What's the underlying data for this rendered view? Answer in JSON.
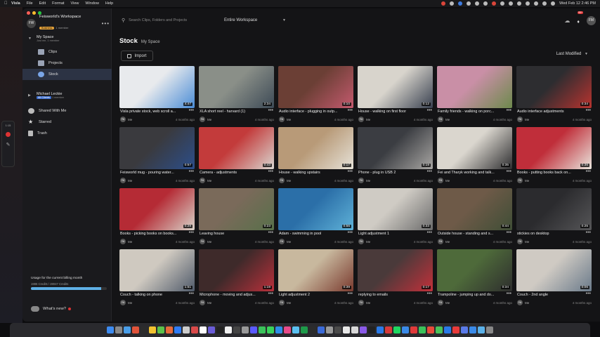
{
  "menubar": {
    "app": "Visla",
    "items": [
      "File",
      "Edit",
      "Format",
      "View",
      "Window",
      "Help"
    ],
    "clock": "Wed Feb 12  2:46 PM"
  },
  "floatbar": {
    "timer": "1:15"
  },
  "workspace": {
    "avatar": "FW",
    "name": "Feisworld's Workspace",
    "badge": "Business",
    "members": "1 member"
  },
  "search": {
    "placeholder": "Search Clips, Folders and Projects"
  },
  "scope": {
    "value": "Entire Workspace"
  },
  "user_avatar": "FM",
  "notifications": {
    "count": "99+"
  },
  "sidebar": {
    "my_space": {
      "label": "My Space",
      "sub": "Just me, 1 member"
    },
    "items": [
      {
        "label": "Clips"
      },
      {
        "label": "Projects"
      },
      {
        "label": "Stock"
      }
    ],
    "michael": {
      "label": "Michael Leckie",
      "badge": "All Clients",
      "sub": "1 member"
    },
    "shared": "Shared With Me",
    "starred": "Starred",
    "trash": "Trash"
  },
  "usage": {
    "title": "Usage for the current billing month",
    "credits": "1986 Credits / 28047 Credits",
    "fraction": 0.93
  },
  "whats_new": "What's new?",
  "page": {
    "title": "Stock",
    "subtitle": "My Space"
  },
  "import_label": "Import",
  "sort_label": "Last Modified",
  "owner": "Me",
  "owner_initials": "FM",
  "clips": [
    {
      "title": "Visla private stock, web scroll a...",
      "duration": "4:47",
      "ago": "4 months ago",
      "c1": "#e8eaed",
      "c2": "#4a8cd6"
    },
    {
      "title": "XLA short reel - harvard (1)",
      "duration": "2:34",
      "ago": "4 months ago",
      "c1": "#8a8f88",
      "c2": "#3d4a56"
    },
    {
      "title": "Audio interface - plugging in outp...",
      "duration": "0:10",
      "ago": "4 months ago",
      "c1": "#6b3f35",
      "c2": "#c45a6e"
    },
    {
      "title": "House - walking on first floor",
      "duration": "0:12",
      "ago": "4 months ago",
      "c1": "#d8d4cc",
      "c2": "#394150"
    },
    {
      "title": "Family friends - walking on porc...",
      "duration": "",
      "ago": "4 months ago",
      "c1": "#c98fa6",
      "c2": "#6d8a4c"
    },
    {
      "title": "Audio interface adjustments",
      "duration": "0:34",
      "ago": "4 months ago",
      "c1": "#2d2d30",
      "c2": "#b8332f"
    },
    {
      "title": "Feisworld mug - pouring water...",
      "duration": "0:57",
      "ago": "4 months ago",
      "c1": "#3a3a3e",
      "c2": "#2c4e8a"
    },
    {
      "title": "Camera - adjustments",
      "duration": "0:43",
      "ago": "4 months ago",
      "c1": "#c33b3b",
      "c2": "#d9d6d0"
    },
    {
      "title": "House - walking upstairs",
      "duration": "0:17",
      "ago": "4 months ago",
      "c1": "#b89a78",
      "c2": "#e6e2d8"
    },
    {
      "title": "Phone - plug in USB 2",
      "duration": "0:19",
      "ago": "4 months ago",
      "c1": "#3b3d42",
      "c2": "#a8a6a3"
    },
    {
      "title": "Fei and Tharyk working and talk...",
      "duration": "0:35",
      "ago": "4 months ago",
      "c1": "#dad6ce",
      "c2": "#2e2e30"
    },
    {
      "title": "Books - putting books back on...",
      "duration": "0:36",
      "ago": "4 months ago",
      "c1": "#c02e3a",
      "c2": "#e9e5dd"
    },
    {
      "title": "Books - picking books on books...",
      "duration": "0:29",
      "ago": "4 months ago",
      "c1": "#b52b35",
      "c2": "#d8d2c8"
    },
    {
      "title": "Leaving house",
      "duration": "0:23",
      "ago": "4 months ago",
      "c1": "#7a6a5a",
      "c2": "#58704a"
    },
    {
      "title": "Adam - swimming in pool",
      "duration": "0:56",
      "ago": "4 months ago",
      "c1": "#2b6fa8",
      "c2": "#5fb2d8"
    },
    {
      "title": "Light adjustment 1",
      "duration": "0:33",
      "ago": "4 months ago",
      "c1": "#cfcbc4",
      "c2": "#6b6b6b"
    },
    {
      "title": "Outside house - standing and s...",
      "duration": "0:44",
      "ago": "4 months ago",
      "c1": "#6e5a48",
      "c2": "#3f4e36"
    },
    {
      "title": "stickies on desktop",
      "duration": "0:25",
      "ago": "4 months ago",
      "c1": "#2b2b2e",
      "c2": "#565658"
    },
    {
      "title": "Couch - talking on phone",
      "duration": "1:51",
      "ago": "4 months ago",
      "c1": "#cfc9c0",
      "c2": "#4f5a6a"
    },
    {
      "title": "Microphone - moving and adjus...",
      "duration": "1:19",
      "ago": "4 months ago",
      "c1": "#3e2a2a",
      "c2": "#b9303b"
    },
    {
      "title": "Light adjustment 2",
      "duration": "0:39",
      "ago": "4 months ago",
      "c1": "#c8b89e",
      "c2": "#7a3a2e"
    },
    {
      "title": "replying to emails",
      "duration": "0:17",
      "ago": "4 months ago",
      "c1": "#4a3a3a",
      "c2": "#c2303a"
    },
    {
      "title": "Trampoline - jumping up and do...",
      "duration": "0:34",
      "ago": "4 months ago",
      "c1": "#4e6a3a",
      "c2": "#2e2e2e"
    },
    {
      "title": "Couch - 2nd angle",
      "duration": "0:06",
      "ago": "4 months ago",
      "c1": "#cfcac3",
      "c2": "#6a7a8a"
    }
  ],
  "colors": {
    "accent": "#5fb0e6",
    "active_nav": "#2c3344",
    "badge": "#e9a53a",
    "danger": "#dd3333"
  }
}
